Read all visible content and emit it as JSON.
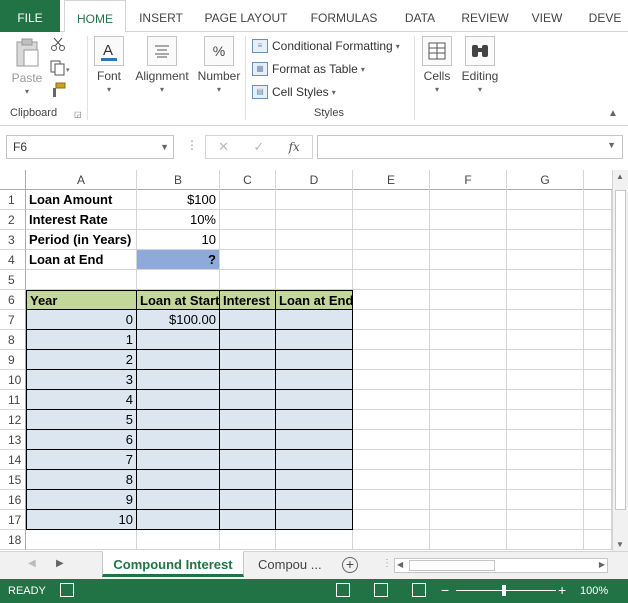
{
  "ribbon": {
    "tabs": [
      {
        "label": "FILE"
      },
      {
        "label": "HOME"
      },
      {
        "label": "INSERT"
      },
      {
        "label": "PAGE LAYOUT"
      },
      {
        "label": "FORMULAS"
      },
      {
        "label": "DATA"
      },
      {
        "label": "REVIEW"
      },
      {
        "label": "VIEW"
      },
      {
        "label": "DEVE"
      }
    ],
    "clipboard": {
      "paste": "Paste",
      "group": "Clipboard"
    },
    "font": "Font",
    "alignment": "Alignment",
    "number": "Number",
    "styles": {
      "conditional_formatting": "Conditional Formatting",
      "format_as_table": "Format as Table",
      "cell_styles": "Cell Styles",
      "group": "Styles"
    },
    "cells": "Cells",
    "editing": "Editing"
  },
  "formula_bar": {
    "name_box": "F6",
    "formula": ""
  },
  "columns": [
    "A",
    "B",
    "C",
    "D",
    "E",
    "F",
    "G"
  ],
  "rows": [
    "1",
    "2",
    "3",
    "4",
    "5",
    "6",
    "7",
    "8",
    "9",
    "10",
    "11",
    "12",
    "13",
    "14",
    "15",
    "16",
    "17",
    "18"
  ],
  "cells": {
    "A1": "Loan Amount",
    "B1": "$100",
    "A2": "Interest Rate",
    "B2": "10%",
    "A3": "Period (in Years)",
    "B3": "10",
    "A4": "Loan at End",
    "B4": "?",
    "A6": "Year",
    "B6": "Loan at Start",
    "C6": "Interest",
    "D6": "Loan at End",
    "A7": "0",
    "B7": "$100.00",
    "A8": "1",
    "A9": "2",
    "A10": "3",
    "A11": "4",
    "A12": "5",
    "A13": "6",
    "A14": "7",
    "A15": "8",
    "A16": "9",
    "A17": "10"
  },
  "sheets": [
    {
      "label": "Compound Interest",
      "active": true
    },
    {
      "label": "Compou ...",
      "active": false
    }
  ],
  "status": {
    "mode": "READY",
    "zoom": "100%",
    "zoom_percent": 100
  },
  "colors": {
    "accent": "#217346",
    "table_header": "#c4d79b",
    "table_body": "#dce6f1",
    "highlight": "#8eaadb"
  }
}
